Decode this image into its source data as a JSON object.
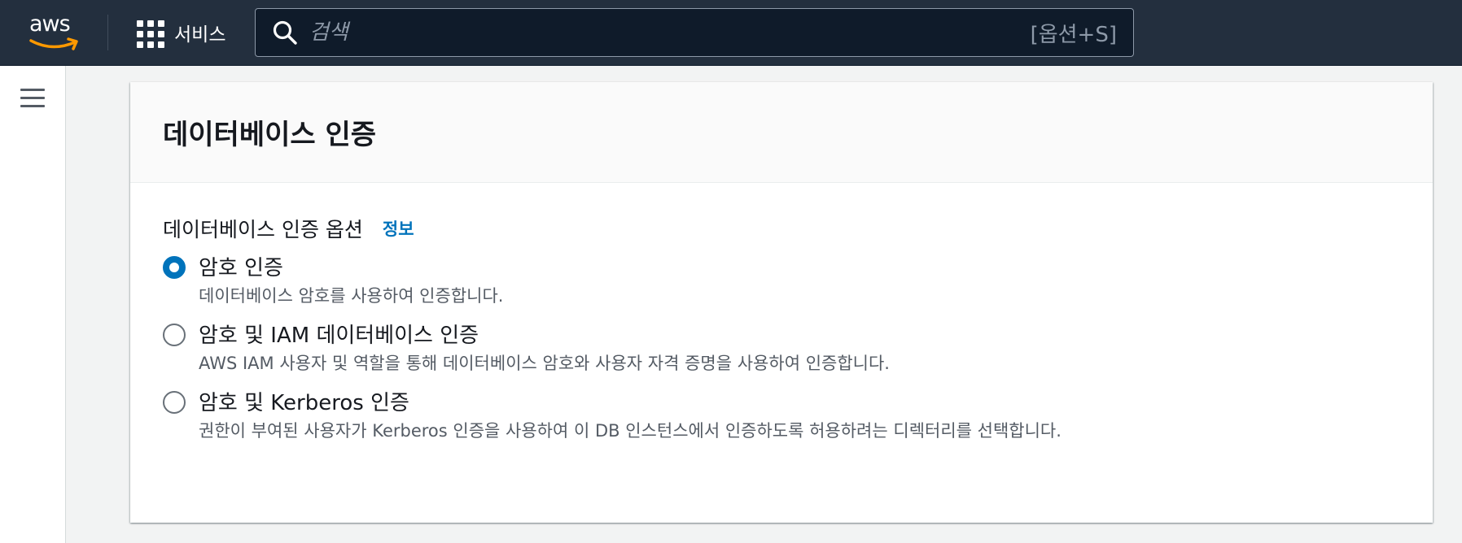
{
  "topnav": {
    "logo_text": "aws",
    "services_label": "서비스",
    "search_placeholder": "검색",
    "search_shortcut": "[옵션+S]"
  },
  "card": {
    "title": "데이터베이스 인증",
    "field_label": "데이터베이스 인증 옵션",
    "info_link": "정보",
    "options": [
      {
        "label": "암호 인증",
        "description": "데이터베이스 암호를 사용하여 인증합니다.",
        "selected": true
      },
      {
        "label": "암호 및 IAM 데이터베이스 인증",
        "description": "AWS IAM 사용자 및 역할을 통해 데이터베이스 암호와 사용자 자격 증명을 사용하여 인증합니다.",
        "selected": false
      },
      {
        "label": "암호 및 Kerberos 인증",
        "description": "권한이 부여된 사용자가 Kerberos 인증을 사용하여 이 DB 인스턴스에서 인증하도록 허용하려는 디렉터리를 선택합니다.",
        "selected": false
      }
    ]
  },
  "colors": {
    "nav_bg": "#232f3e",
    "accent": "#0073bb",
    "smile": "#ff9900"
  }
}
